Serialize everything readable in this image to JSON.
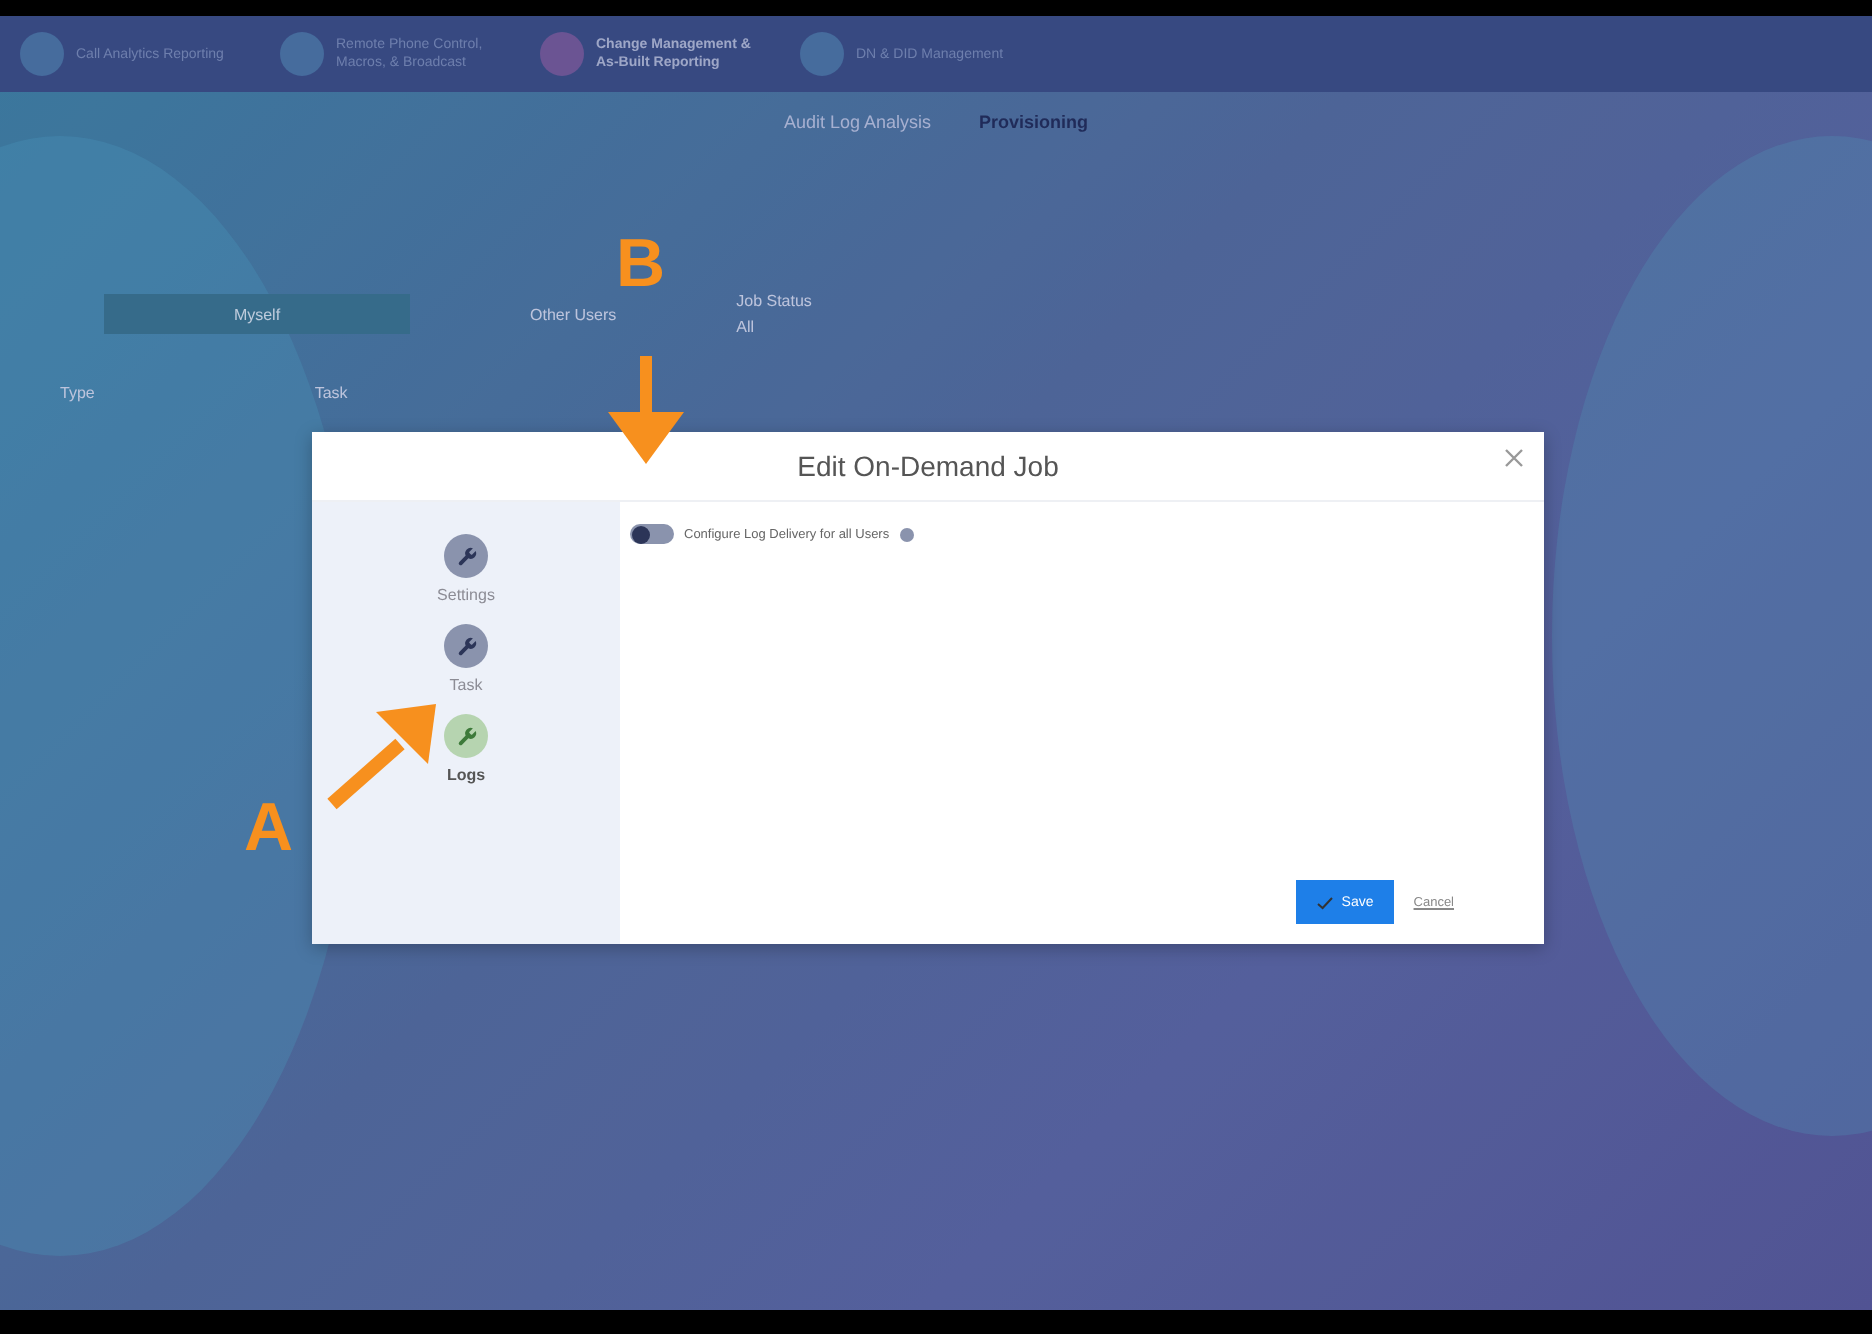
{
  "nav": [
    {
      "label": "Call Analytics Reporting",
      "selected": false
    },
    {
      "label": "Remote Phone Control, Macros, & Broadcast",
      "selected": false
    },
    {
      "label": "Change Management & As-Built Reporting",
      "selected": true
    },
    {
      "label": "DN & DID Management",
      "selected": false
    }
  ],
  "tabs": [
    {
      "label": "Audit Log Analysis",
      "selected": false
    },
    {
      "label": "Provisioning",
      "selected": true
    }
  ],
  "filters": {
    "owner_button": "Myself",
    "other_users": "Other Users",
    "status_label": "Job Status",
    "status_value": "All"
  },
  "table": {
    "columns": [
      "Type",
      "Task"
    ]
  },
  "modal": {
    "title": "Edit On-Demand Job",
    "steps": [
      {
        "label": "Settings",
        "selected": false
      },
      {
        "label": "Task",
        "selected": false
      },
      {
        "label": "Logs",
        "selected": true
      }
    ],
    "toggle": {
      "label": "Configure Log Delivery for all Users",
      "on": false
    },
    "save": "Save",
    "cancel": "Cancel"
  },
  "annotations": [
    {
      "label": "A",
      "kind": "up-right"
    },
    {
      "label": "B",
      "kind": "down"
    }
  ]
}
